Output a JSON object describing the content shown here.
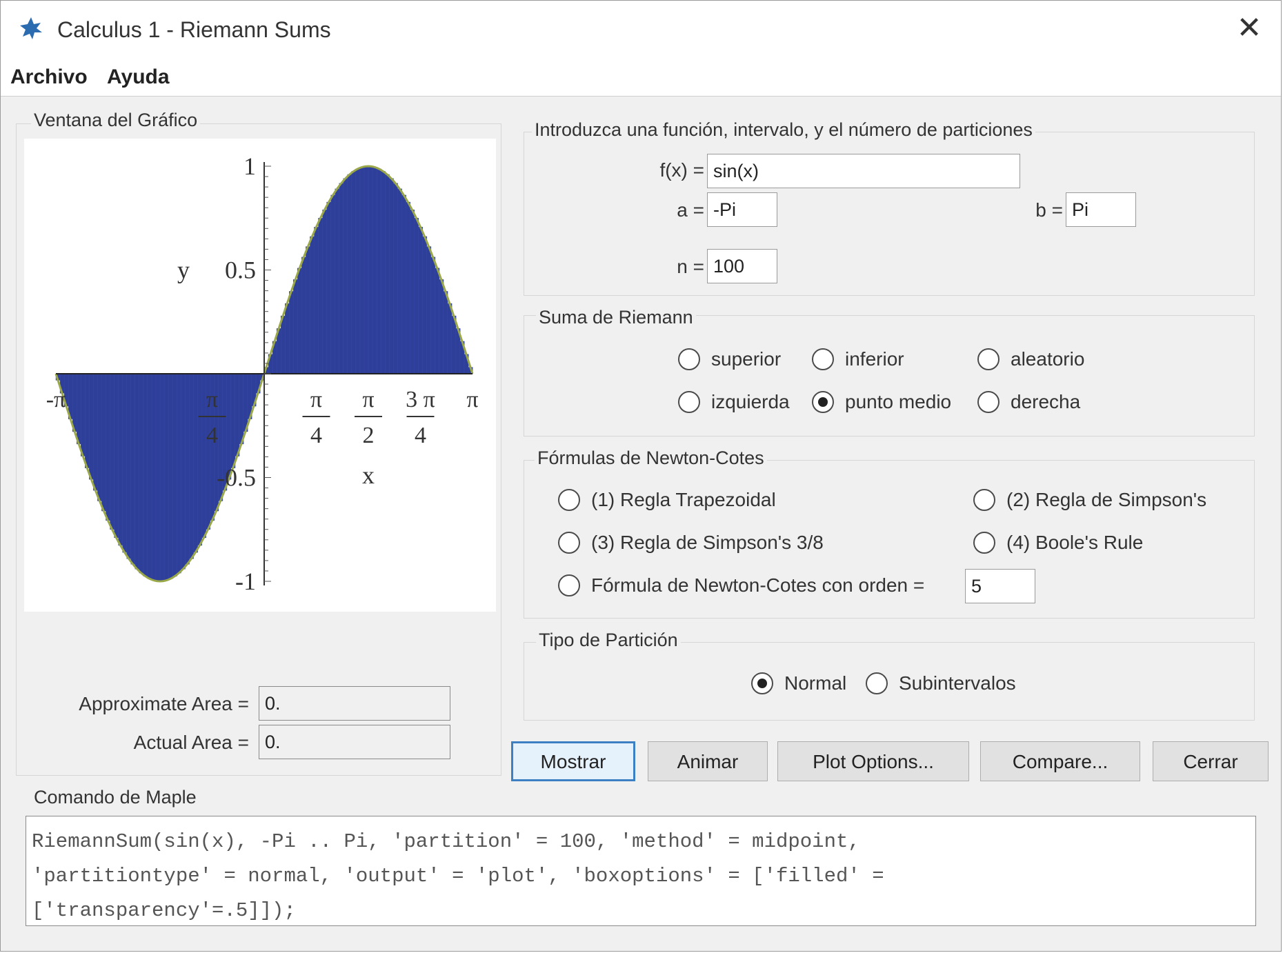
{
  "window": {
    "title": "Calculus 1 - Riemann Sums",
    "close_glyph": "✕"
  },
  "menu": [
    "Archivo",
    "Ayuda"
  ],
  "graph_panel": {
    "label": "Ventana del Gráfico",
    "approximate_area_label": "Approximate Area =",
    "approximate_area_value": "0.",
    "actual_area_label": "Actual Area =",
    "actual_area_value": "0."
  },
  "chart_data": {
    "type": "bar",
    "function": "sin(x)",
    "xlim": [
      -3.14159,
      3.14159
    ],
    "ylim": [
      -1,
      1
    ],
    "n": 100,
    "xlabel": "x",
    "ylabel": "y",
    "y_ticks": [
      "1",
      "0.5",
      "-0.5",
      "-1"
    ],
    "x_ticks": [
      {
        "num": "-π",
        "den": ""
      },
      {
        "num": "π",
        "den": "4"
      },
      {
        "num": "π",
        "den": "4"
      },
      {
        "num": "π",
        "den": "2"
      },
      {
        "num": "3 π",
        "den": "4"
      },
      {
        "num": "π",
        "den": ""
      }
    ],
    "fill_color": "#2e3f9a",
    "curve_color": "#9aa84a"
  },
  "input_panel": {
    "label": "Introduzca una función, intervalo, y el número de particiones",
    "fx_label": "f(x) =",
    "fx_value": "sin(x)",
    "a_label": "a =",
    "a_value": "-Pi",
    "b_label": "b =",
    "b_value": "Pi",
    "n_label": "n =",
    "n_value": "100"
  },
  "riemann_panel": {
    "label": "Suma de Riemann",
    "options": [
      "superior",
      "inferior",
      "aleatorio",
      "izquierda",
      "punto medio",
      "derecha"
    ],
    "selected": "punto medio"
  },
  "newton_panel": {
    "label": "Fórmulas de Newton-Cotes",
    "options": [
      "(1) Regla Trapezoidal",
      "(2) Regla de Simpson's",
      "(3) Regla de Simpson's 3/8",
      "(4) Boole's Rule",
      "Fórmula de Newton-Cotes con orden ="
    ],
    "order_value": "5"
  },
  "partition_panel": {
    "label": "Tipo de Partición",
    "options": [
      "Normal",
      "Subintervalos"
    ],
    "selected": "Normal"
  },
  "buttons": {
    "show": "Mostrar",
    "animate": "Animar",
    "plot_options": "Plot Options...",
    "compare": "Compare...",
    "close": "Cerrar"
  },
  "command_panel": {
    "label": "Comando de Maple",
    "text": "RiemannSum(sin(x), -Pi .. Pi, 'partition' = 100, 'method' = midpoint,\n'partitiontype' = normal, 'output' = 'plot', 'boxoptions' = ['filled' =\n['transparency'=.5]]);"
  }
}
